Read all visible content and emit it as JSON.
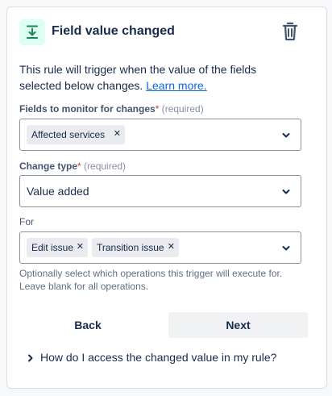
{
  "header": {
    "icon": "field-value-changed-icon",
    "title": "Field value changed",
    "delete_icon": "trash-icon"
  },
  "description": {
    "text": "This rule will trigger when the value of the fields selected below changes.",
    "link": "Learn more."
  },
  "fields_to_monitor": {
    "label": "Fields to monitor for changes",
    "required_star": "*",
    "required_text": "(required)",
    "tags": [
      "Affected services"
    ]
  },
  "change_type": {
    "label": "Change type",
    "required_star": "*",
    "required_text": "(required)",
    "value": "Value added"
  },
  "for": {
    "label": "For",
    "tags": [
      "Edit issue",
      "Transition issue"
    ],
    "helper": "Optionally select which operations this trigger will execute for. Leave blank for all operations."
  },
  "buttons": {
    "back": "Back",
    "next": "Next"
  },
  "expander": {
    "label": "How do I access the changed value in my rule?"
  },
  "colors": {
    "accent_link": "#0c66e4",
    "icon_bg": "#dcfff1",
    "icon_fg": "#1f845a",
    "required": "#c9372c"
  }
}
